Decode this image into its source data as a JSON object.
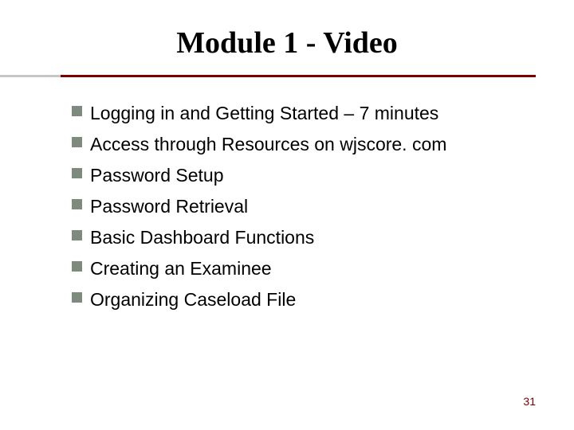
{
  "slide": {
    "title": "Module 1 - Video",
    "bullets": [
      "Logging in and Getting Started – 7 minutes",
      "Access through Resources on wjscore. com",
      "Password Setup",
      "Password Retrieval",
      "Basic Dashboard Functions",
      "Creating an Examinee",
      "Organizing Caseload File"
    ],
    "page_number": "31"
  }
}
